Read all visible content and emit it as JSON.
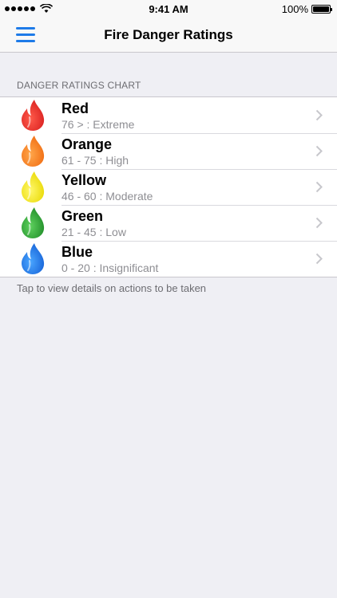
{
  "status_bar": {
    "time": "9:41 AM",
    "battery": "100%"
  },
  "nav": {
    "title": "Fire Danger Ratings",
    "menu_icon": "hamburger-menu-icon"
  },
  "section_header": "DANGER RATINGS CHART",
  "ratings": [
    {
      "label": "Red",
      "range": "76 > : Extreme",
      "color": "#d81f1f",
      "light": "#ff5a4a",
      "icon": "flame-icon"
    },
    {
      "label": "Orange",
      "range": "61 - 75 : High",
      "color": "#f06a10",
      "light": "#ffa64a",
      "icon": "flame-icon"
    },
    {
      "label": "Yellow",
      "range": "46 - 60 : Moderate",
      "color": "#e8d800",
      "light": "#fff76a",
      "icon": "flame-icon"
    },
    {
      "label": "Green",
      "range": "21 - 45 : Low",
      "color": "#1e8a26",
      "light": "#5ed15e",
      "icon": "flame-icon"
    },
    {
      "label": "Blue",
      "range": "0 - 20 : Insignificant",
      "color": "#1560d6",
      "light": "#4aa6ff",
      "icon": "flame-icon"
    }
  ],
  "footer": "Tap to view details on actions to be taken",
  "colors": {
    "accent": "#1e7be8",
    "background": "#efeff4"
  }
}
